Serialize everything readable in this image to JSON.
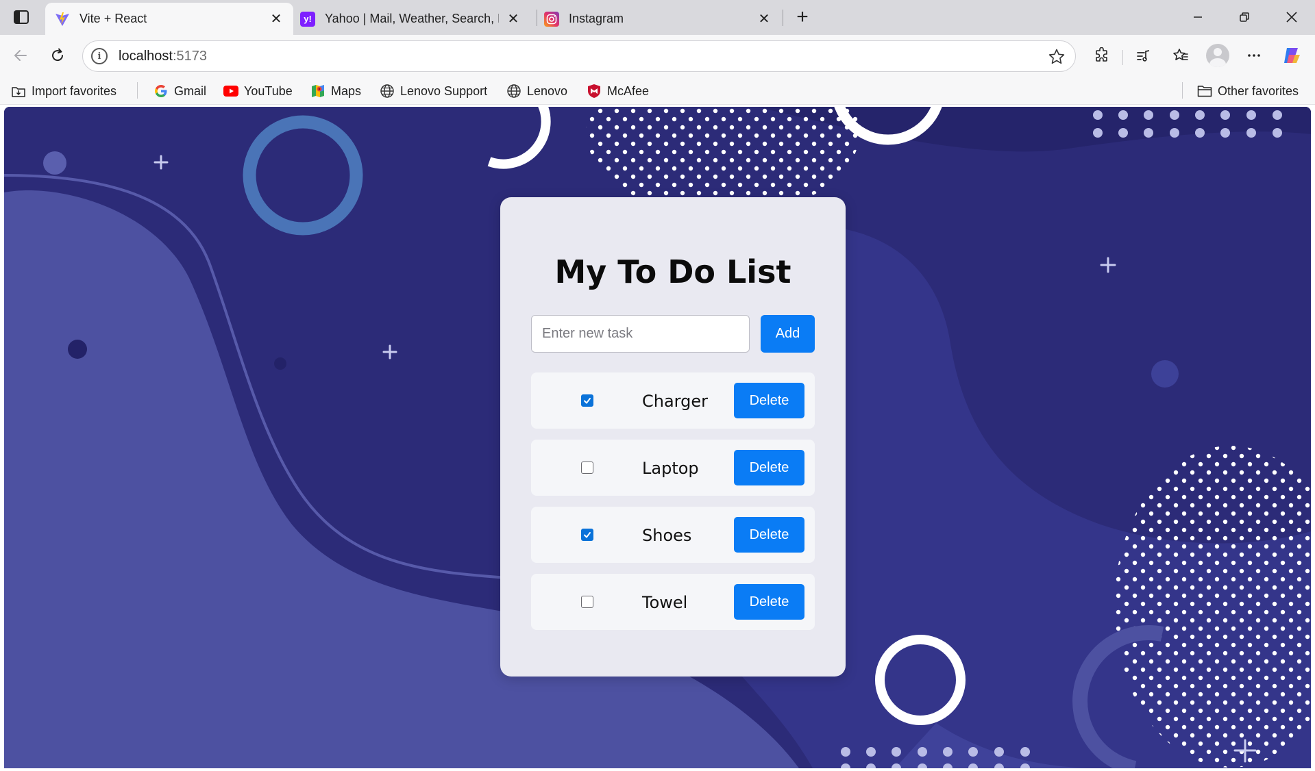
{
  "browser": {
    "tabs": [
      {
        "title": "Vite + React",
        "active": true
      },
      {
        "title": "Yahoo | Mail, Weather, Search, Pol",
        "active": false
      },
      {
        "title": "Instagram",
        "active": false
      }
    ],
    "address": {
      "host": "localhost",
      "port": ":5173"
    },
    "favorites": [
      {
        "label": "Import favorites",
        "icon": "import-icon"
      },
      {
        "label": "Gmail",
        "icon": "google-icon"
      },
      {
        "label": "YouTube",
        "icon": "youtube-icon"
      },
      {
        "label": "Maps",
        "icon": "maps-icon"
      },
      {
        "label": "Lenovo Support",
        "icon": "globe-icon"
      },
      {
        "label": "Lenovo",
        "icon": "globe-icon"
      },
      {
        "label": "McAfee",
        "icon": "mcafee-icon"
      }
    ],
    "other_favorites": "Other favorites"
  },
  "app": {
    "title": "My To Do List",
    "input": {
      "placeholder": "Enter new task",
      "value": ""
    },
    "add_label": "Add",
    "tasks": [
      {
        "label": "Charger",
        "done": true,
        "delete_label": "Delete"
      },
      {
        "label": "Laptop",
        "done": false,
        "delete_label": "Delete"
      },
      {
        "label": "Shoes",
        "done": true,
        "delete_label": "Delete"
      },
      {
        "label": "Towel",
        "done": false,
        "delete_label": "Delete"
      }
    ]
  },
  "colors": {
    "accent": "#0a7cf5",
    "checkbox_on": "#0a72d9",
    "background": "#2c2b78",
    "card": "#e9e9f1"
  }
}
